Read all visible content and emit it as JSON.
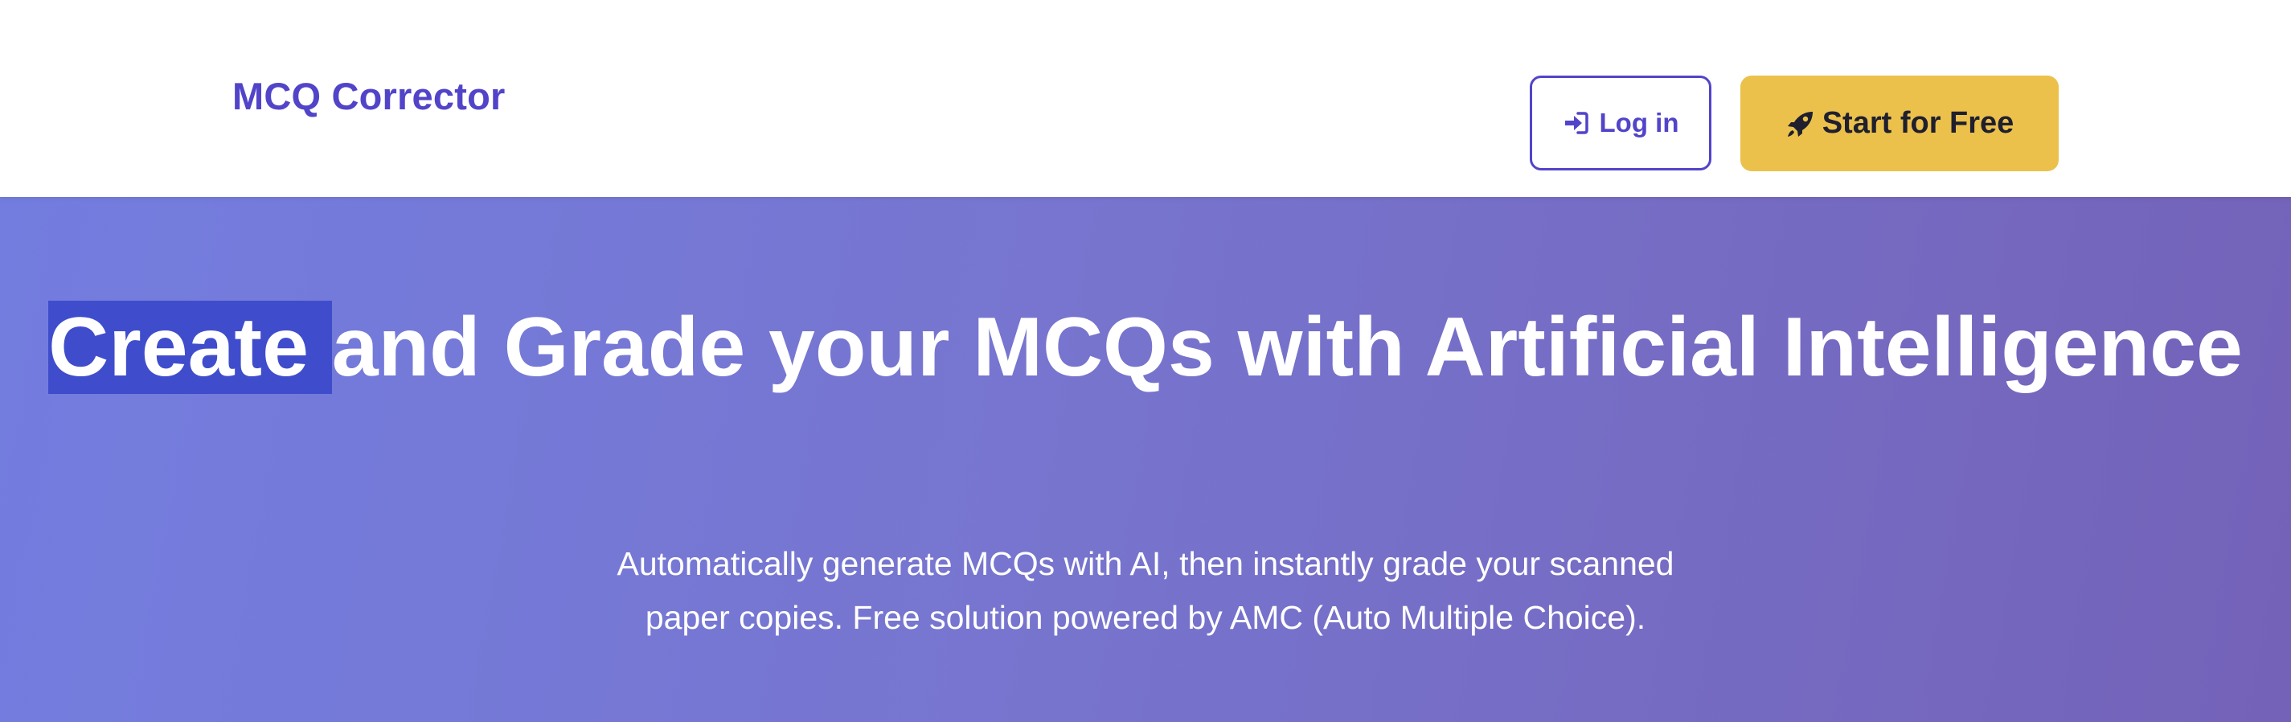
{
  "navbar": {
    "brand": "MCQ Corrector",
    "login_label": "Log in",
    "start_label": "Start for Free",
    "login_icon": "sign-in-icon",
    "start_icon": "rocket-icon"
  },
  "hero": {
    "title_highlight": "Create ",
    "title_rest": "and Grade your MCQs with Artificial Intelligence",
    "subtitle": "Automatically generate MCQs with AI, then instantly grade your scanned paper copies. Free solution powered by AMC (Auto Multiple Choice)."
  },
  "colors": {
    "brand": "#5244c9",
    "cta": "#ebc14c",
    "hero_start": "#737ddf",
    "hero_end": "#7462b8",
    "selection": "#3f4dcc"
  }
}
